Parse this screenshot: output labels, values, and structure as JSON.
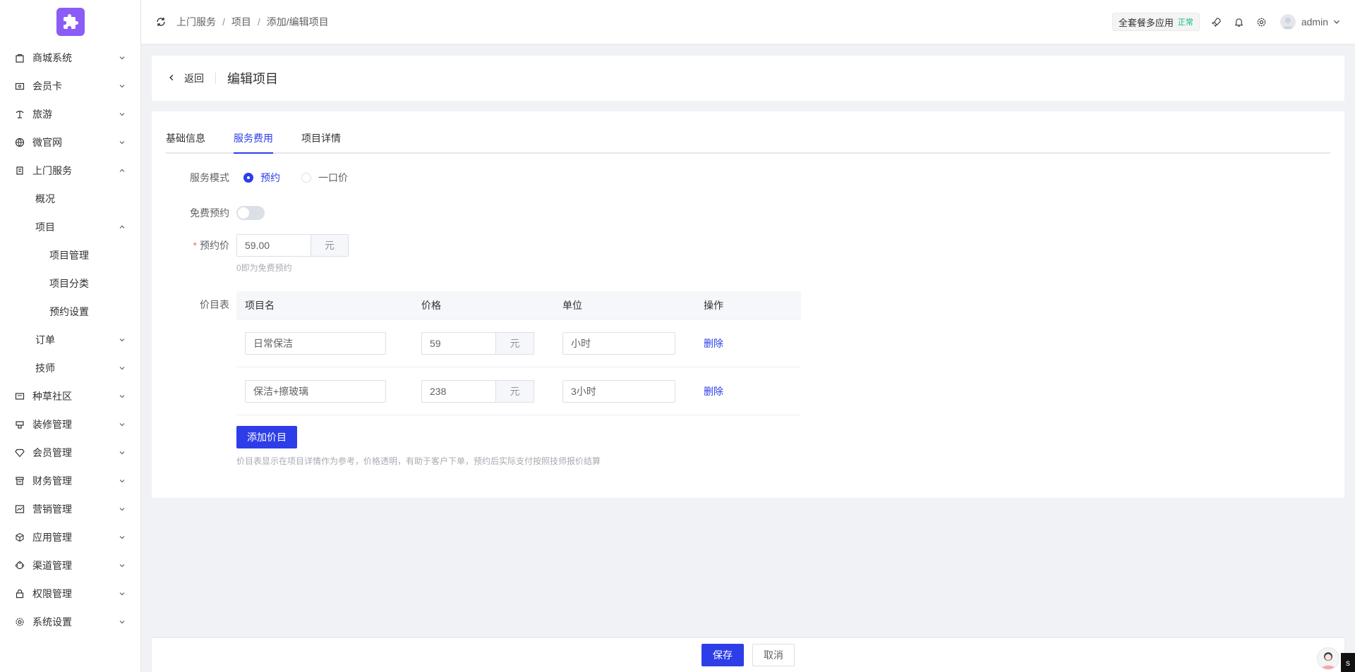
{
  "sidebar": {
    "items": [
      {
        "label": "商城系统",
        "icon": "bag-icon",
        "expanded": false
      },
      {
        "label": "会员卡",
        "icon": "card-icon",
        "expanded": false
      },
      {
        "label": "旅游",
        "icon": "travel-icon",
        "expanded": false
      },
      {
        "label": "微官网",
        "icon": "globe-icon",
        "expanded": false
      },
      {
        "label": "上门服务",
        "icon": "home-service-icon",
        "expanded": true
      },
      {
        "label": "概况"
      },
      {
        "label": "项目",
        "expanded": true
      },
      {
        "label": "项目管理"
      },
      {
        "label": "项目分类"
      },
      {
        "label": "预约设置"
      },
      {
        "label": "订单",
        "expanded": false
      },
      {
        "label": "技师",
        "expanded": false
      },
      {
        "label": "种草社区",
        "icon": "community-icon",
        "expanded": false
      },
      {
        "label": "装修管理",
        "icon": "decorate-icon",
        "expanded": false
      },
      {
        "label": "会员管理",
        "icon": "diamond-icon",
        "expanded": false
      },
      {
        "label": "财务管理",
        "icon": "finance-icon",
        "expanded": false
      },
      {
        "label": "营销管理",
        "icon": "chart-icon",
        "expanded": false
      },
      {
        "label": "应用管理",
        "icon": "box-icon",
        "expanded": false
      },
      {
        "label": "渠道管理",
        "icon": "channel-icon",
        "expanded": false
      },
      {
        "label": "权限管理",
        "icon": "lock-icon",
        "expanded": false
      },
      {
        "label": "系统设置",
        "icon": "gear-icon",
        "expanded": false
      }
    ]
  },
  "header": {
    "breadcrumb": [
      "上门服务",
      "项目",
      "添加/编辑项目"
    ],
    "plan_label": "全套餐多应用",
    "plan_status": "正常",
    "username": "admin"
  },
  "page": {
    "back_label": "返回",
    "title": "编辑项目"
  },
  "tabs": [
    "基础信息",
    "服务费用",
    "项目详情"
  ],
  "active_tab": "服务费用",
  "form": {
    "mode_label": "服务模式",
    "mode_options": [
      "预约",
      "一口价"
    ],
    "mode_selected": "预约",
    "free_label": "免费预约",
    "free_enabled": false,
    "price_label": "预约价",
    "price_value": "59.00",
    "price_unit": "元",
    "price_hint": "0即为免费预约",
    "table_label": "价目表",
    "table_headers": [
      "项目名",
      "价格",
      "单位",
      "操作"
    ],
    "rows": [
      {
        "name": "日常保洁",
        "price": "59",
        "currency": "元",
        "unit": "小时",
        "action": "删除"
      },
      {
        "name": "保洁+擦玻璃",
        "price": "238",
        "currency": "元",
        "unit": "3小时",
        "action": "删除"
      }
    ],
    "add_button": "添加价目",
    "table_hint": "价目表显示在项目详情作为参考，价格透明，有助于客户下单，预约后实际支付按照技师报价结算"
  },
  "footer": {
    "save": "保存",
    "cancel": "取消"
  },
  "corner_text": "s",
  "colors": {
    "primary": "#2d3ee8",
    "logo": "#8b5cf6",
    "status_ok": "#10b981",
    "required": "#f56c6c"
  }
}
